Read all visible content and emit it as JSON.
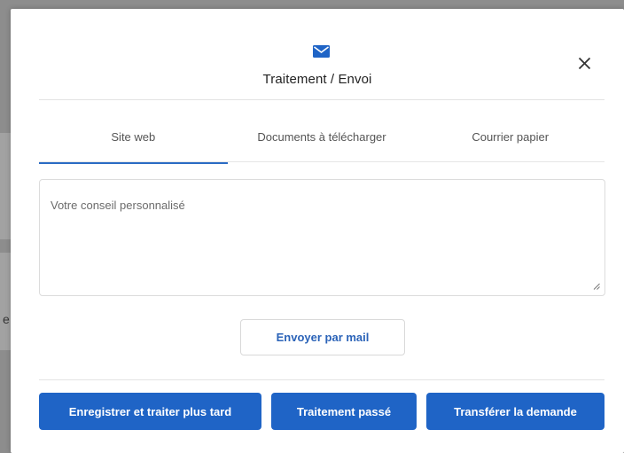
{
  "dialog": {
    "title": "Traitement / Envoi",
    "header_icon": "mail-icon",
    "close_icon": "close-icon"
  },
  "tabs": [
    {
      "label": "Site web",
      "active": true
    },
    {
      "label": "Documents à télécharger",
      "active": false
    },
    {
      "label": "Courrier papier",
      "active": false
    }
  ],
  "advice_field": {
    "placeholder": "Votre conseil personnalisé",
    "value": ""
  },
  "send_mail_label": "Envoyer par mail",
  "actions": {
    "save_later_label": "Enregistrer et traiter plus tard",
    "done_label": "Traitement passé",
    "transfer_label": "Transférer la demande"
  },
  "backdrop_text": "e",
  "colors": {
    "accent": "#1f64c6",
    "tab_underline": "#2b6cc4",
    "link_text": "#2b63b8"
  }
}
